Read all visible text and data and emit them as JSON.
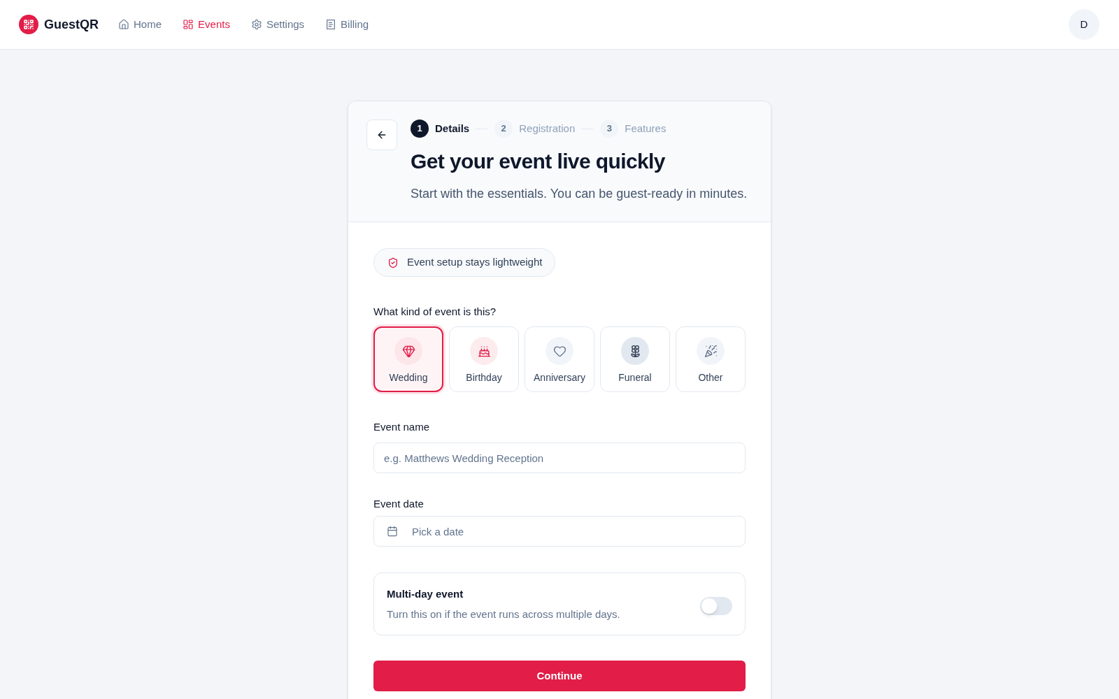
{
  "nav": {
    "brand": "GuestQR",
    "items": [
      {
        "label": "Home",
        "selected": false
      },
      {
        "label": "Events",
        "selected": true
      },
      {
        "label": "Settings",
        "selected": false
      },
      {
        "label": "Billing",
        "selected": false
      }
    ],
    "avatar": "D"
  },
  "wizard": {
    "steps": [
      {
        "number": "1",
        "label": "Details",
        "selected": true
      },
      {
        "number": "2",
        "label": "Registration",
        "selected": false
      },
      {
        "number": "3",
        "label": "Features",
        "selected": false
      }
    ],
    "title": "Get your event live quickly",
    "subtitle": "Start with the essentials. You can be guest-ready in minutes.",
    "badge": "Event setup stays lightweight",
    "event_type": {
      "label": "What kind of event is this?",
      "options": [
        {
          "label": "Wedding",
          "selected": true
        },
        {
          "label": "Birthday",
          "selected": false
        },
        {
          "label": "Anniversary",
          "selected": false
        },
        {
          "label": "Funeral",
          "selected": false
        },
        {
          "label": "Other",
          "selected": false
        }
      ]
    },
    "event_name": {
      "label": "Event name",
      "placeholder": "e.g. Matthews Wedding Reception"
    },
    "event_date": {
      "label": "Event date",
      "placeholder": "Pick a date"
    },
    "multi_day": {
      "title": "Multi-day event",
      "description": "Turn this on if the event runs across multiple days.",
      "on": false
    },
    "continue_button": "Continue"
  }
}
